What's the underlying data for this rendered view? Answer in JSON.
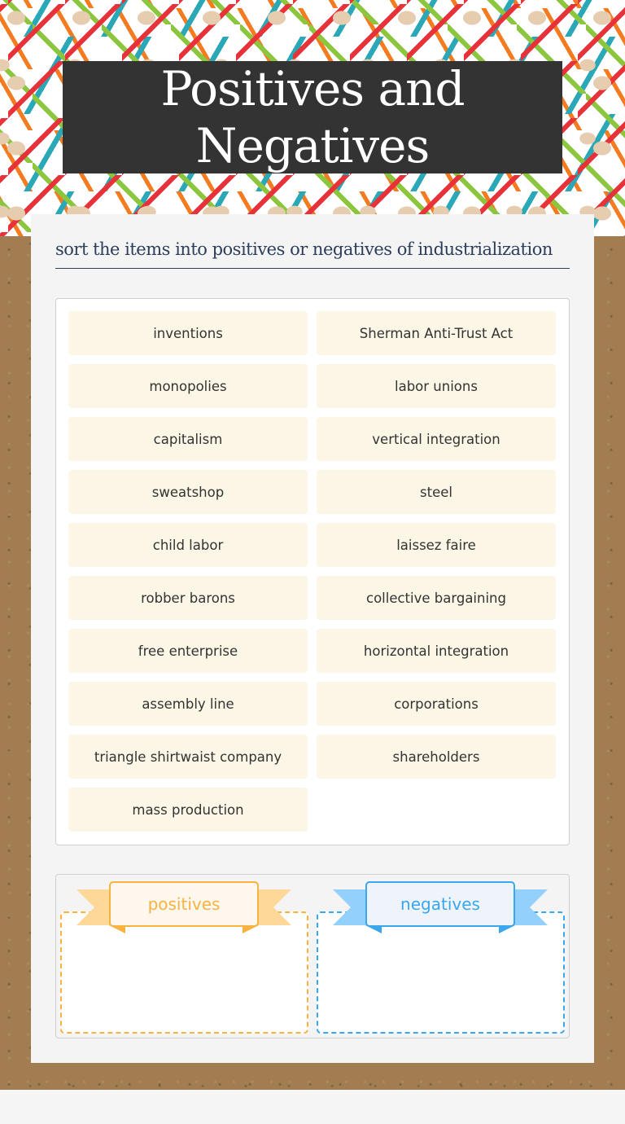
{
  "worksheet": {
    "title": "Positives and Negatives",
    "instructions": "sort the items into positives or negatives of industrialization"
  },
  "items": [
    "inventions",
    "Sherman Anti-Trust Act",
    "monopolies",
    "labor unions",
    "capitalism",
    "vertical integration",
    "sweatshop",
    "steel",
    "child labor",
    "laissez faire",
    "robber barons",
    "collective bargaining",
    "free enterprise",
    "horizontal integration",
    "assembly line",
    "corporations",
    "triangle shirtwaist company",
    "shareholders",
    "mass production"
  ],
  "buckets": {
    "positives": {
      "label": "positives",
      "color": "#f8b240"
    },
    "negatives": {
      "label": "negatives",
      "color": "#3aa6ee"
    }
  }
}
